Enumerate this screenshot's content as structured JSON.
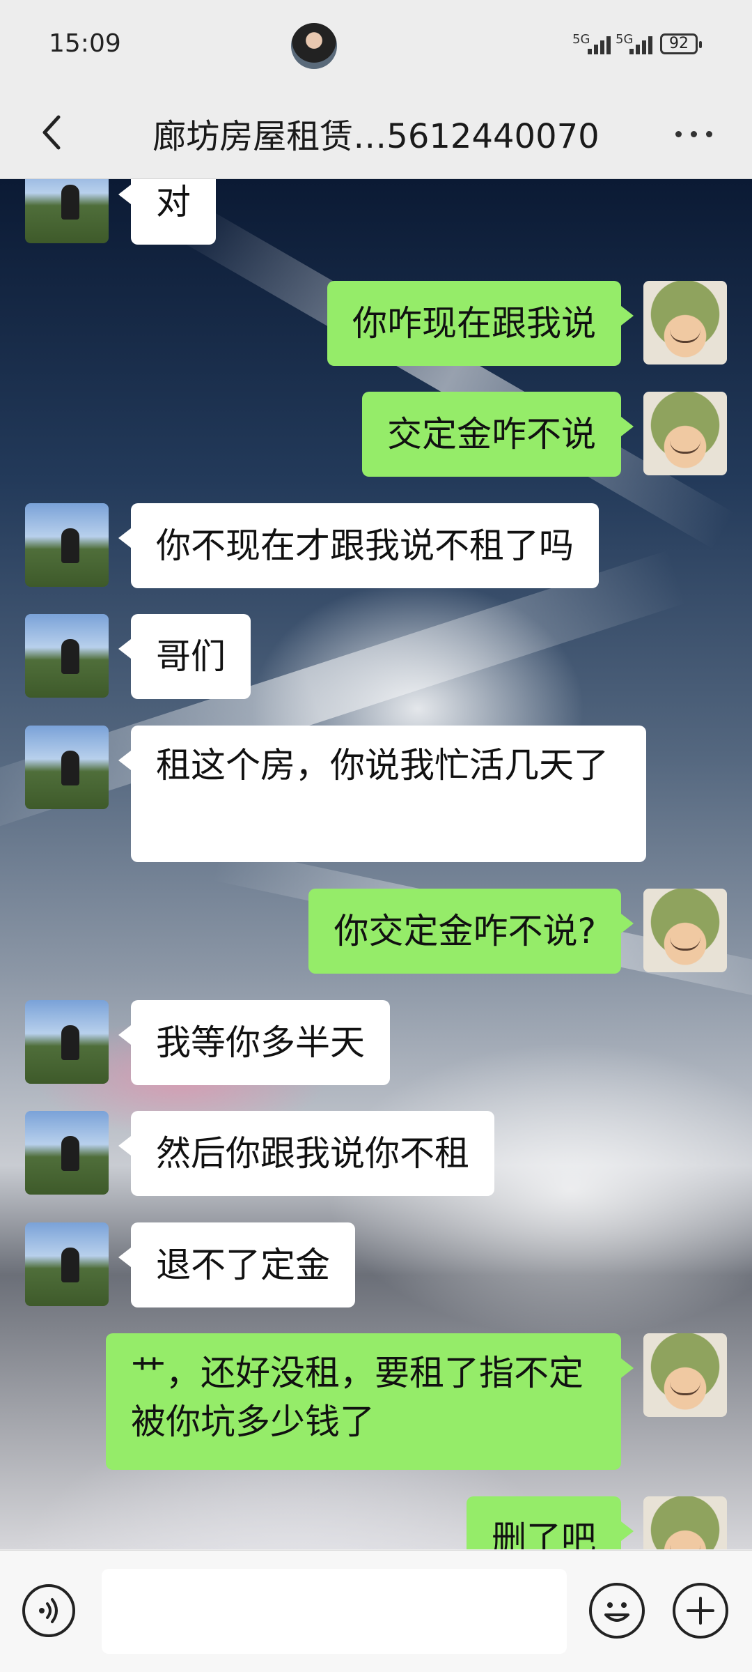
{
  "status_bar": {
    "time": "15:09",
    "signal_1": "5G",
    "signal_2": "5G",
    "battery": "92"
  },
  "nav": {
    "title": "廊坊房屋租赁…5612440070",
    "back_icon": "chevron-left-icon",
    "more_icon": "more-dots-icon"
  },
  "messages": [
    {
      "sender": "peer",
      "text": "对"
    },
    {
      "sender": "self",
      "text": "你咋现在跟我说"
    },
    {
      "sender": "self",
      "text": "交定金咋不说"
    },
    {
      "sender": "peer",
      "text": "你不现在才跟我说不租了吗"
    },
    {
      "sender": "peer",
      "text": "哥们"
    },
    {
      "sender": "peer",
      "text": "租这个房，你说我忙活几天了"
    },
    {
      "sender": "self",
      "text": "你交定金咋不说?"
    },
    {
      "sender": "peer",
      "text": "我等你多半天"
    },
    {
      "sender": "peer",
      "text": "然后你跟我说你不租"
    },
    {
      "sender": "peer",
      "text": "退不了定金"
    },
    {
      "sender": "self",
      "text": "艹，还好没租，要租了指不定被你坑多少钱了"
    },
    {
      "sender": "self",
      "text": "删了吧"
    }
  ],
  "input_bar": {
    "voice_icon": "voice-icon",
    "emoji_icon": "emoji-icon",
    "plus_icon": "plus-icon",
    "text_value": ""
  },
  "colors": {
    "self_bubble": "#95ec69",
    "peer_bubble": "#ffffff",
    "bar_background": "#ededed"
  }
}
